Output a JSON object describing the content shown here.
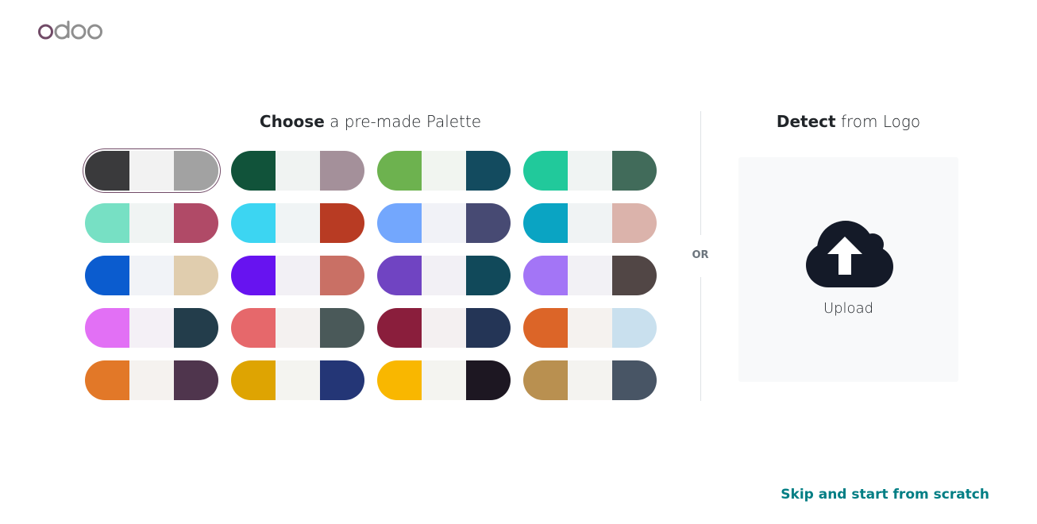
{
  "logo": {
    "text": "odoo"
  },
  "palette_section": {
    "title_bold": "Choose",
    "title_rest": " a pre-made Palette",
    "palettes": [
      {
        "colors": [
          "#3a3a3c",
          "#f2f2f2",
          "#a2a2a2"
        ],
        "selected": true
      },
      {
        "colors": [
          "#11533a",
          "#f0f3f2",
          "#a4909a"
        ],
        "selected": false
      },
      {
        "colors": [
          "#6db24f",
          "#f1f5f0",
          "#134b5f"
        ],
        "selected": false
      },
      {
        "colors": [
          "#21c99b",
          "#f0f4f3",
          "#416b5a"
        ],
        "selected": false
      },
      {
        "colors": [
          "#77e0c4",
          "#f0f4f3",
          "#b04a67"
        ],
        "selected": false
      },
      {
        "colors": [
          "#3cd5f2",
          "#f0f4f5",
          "#b83b23"
        ],
        "selected": false
      },
      {
        "colors": [
          "#73a7fd",
          "#f1f2f7",
          "#474a73"
        ],
        "selected": false
      },
      {
        "colors": [
          "#0aa4c3",
          "#f0f3f4",
          "#dbb3ab"
        ],
        "selected": false
      },
      {
        "colors": [
          "#0b5ccf",
          "#f1f3f7",
          "#e0cdae"
        ],
        "selected": false
      },
      {
        "colors": [
          "#6713f0",
          "#f2f0f5",
          "#c97065"
        ],
        "selected": false
      },
      {
        "colors": [
          "#7044c2",
          "#f2f0f5",
          "#11495a"
        ],
        "selected": false
      },
      {
        "colors": [
          "#a375f6",
          "#f2f1f5",
          "#514645"
        ],
        "selected": false
      },
      {
        "colors": [
          "#e270f5",
          "#f4f0f6",
          "#233d4b"
        ],
        "selected": false
      },
      {
        "colors": [
          "#e6686b",
          "#f4f1f0",
          "#4a5959"
        ],
        "selected": false
      },
      {
        "colors": [
          "#8a1e3c",
          "#f4f0f1",
          "#243556"
        ],
        "selected": false
      },
      {
        "colors": [
          "#dc6528",
          "#f5f2ef",
          "#c9e0ee"
        ],
        "selected": false
      },
      {
        "colors": [
          "#e27828",
          "#f5f2ef",
          "#4f354d"
        ],
        "selected": false
      },
      {
        "colors": [
          "#dea402",
          "#f4f4f0",
          "#243676"
        ],
        "selected": false
      },
      {
        "colors": [
          "#f9b700",
          "#f4f4f0",
          "#1d1722"
        ],
        "selected": false
      },
      {
        "colors": [
          "#b99050",
          "#f4f3f0",
          "#485565"
        ],
        "selected": false
      }
    ]
  },
  "divider": {
    "label": "OR"
  },
  "logo_section": {
    "title_bold": "Detect",
    "title_rest": " from Logo",
    "upload_label": "Upload",
    "icon": "cloud-upload-icon"
  },
  "footer": {
    "skip_label": "Skip and start from scratch"
  },
  "colors": {
    "brand": "#714b67",
    "link": "#017e84",
    "icon": "#141a28"
  }
}
